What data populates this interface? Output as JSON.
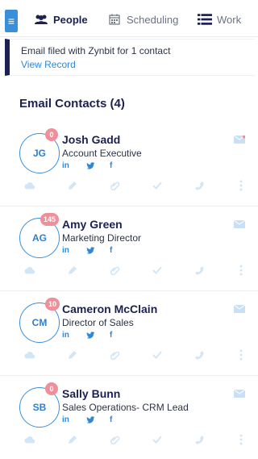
{
  "nav": {
    "tabs": [
      {
        "label": "People",
        "active": true,
        "icon": "people-icon"
      },
      {
        "label": "Scheduling",
        "active": false,
        "icon": "calendar-icon"
      },
      {
        "label": "Work",
        "active": false,
        "icon": "list-icon"
      }
    ],
    "menu_icon": "hamburger-icon"
  },
  "banner": {
    "message": "Email filed with Zynbit for 1 contact",
    "link": "View Record"
  },
  "section_title": "Email Contacts (4)",
  "contacts": [
    {
      "initials": "JG",
      "count": "0",
      "name": "Josh Gadd",
      "title": "Account Executive",
      "social": [
        "in",
        "t",
        "f"
      ]
    },
    {
      "initials": "AG",
      "count": "145",
      "name": "Amy Green",
      "title": "Marketing Director",
      "social": [
        "in",
        "t",
        "f"
      ]
    },
    {
      "initials": "CM",
      "count": "10",
      "name": "Cameron McClain",
      "title": "Director of Sales",
      "social": [
        "in",
        "t",
        "f"
      ]
    },
    {
      "initials": "SB",
      "count": "0",
      "name": "Sally Bunn",
      "title": "Sales Operations- CRM Lead",
      "social": [
        "in",
        "t",
        "f"
      ]
    }
  ],
  "colors": {
    "accent": "#3a8fd9",
    "navy": "#1b2150",
    "badge": "#f08f9a",
    "action_icon": "#d3e6f7"
  }
}
